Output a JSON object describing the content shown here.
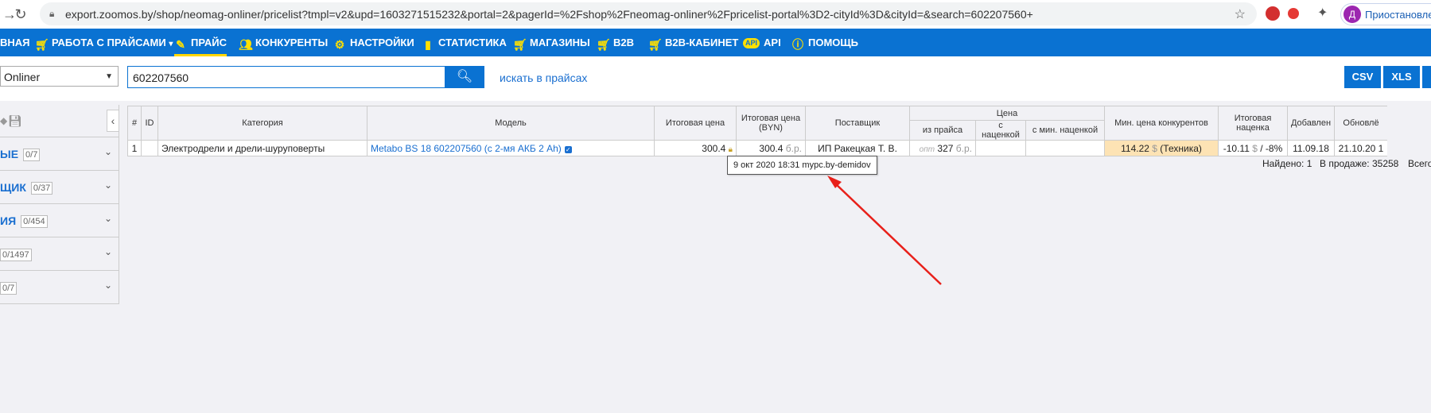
{
  "browser": {
    "url": "export.zoomos.by/shop/neomag-onliner/pricelist?tmpl=v2&upd=1603271515232&portal=2&pagerId=%2Fshop%2Fneomag-onliner%2Fpricelist-portal%3D2-cityId%3D&cityId=&search=602207560+",
    "profile_initial": "Д",
    "profile_label": "Приостановле"
  },
  "nav": {
    "items": [
      {
        "label": "ВНАЯ",
        "icon": "home-icon"
      },
      {
        "label": "РАБОТА С ПРАЙСАМИ",
        "icon": "cart-icon"
      },
      {
        "label": "ПРАЙС",
        "icon": "pricelist-icon"
      },
      {
        "label": "КОНКУРЕНТЫ",
        "icon": "users-icon"
      },
      {
        "label": "НАСТРОЙКИ",
        "icon": "gear-icon"
      },
      {
        "label": "СТАТИСТИКА",
        "icon": "chart-icon"
      },
      {
        "label": "МАГАЗИНЫ",
        "icon": "cart-icon"
      },
      {
        "label": "B2B",
        "icon": "cart-icon"
      },
      {
        "label": "B2B-КАБИНЕТ",
        "icon": "cart-icon"
      },
      {
        "label": "API",
        "icon": "api-icon"
      },
      {
        "label": "ПОМОЩЬ",
        "icon": "info-icon"
      }
    ],
    "api_badge": "API"
  },
  "search": {
    "portal_selected": "Onliner",
    "query": "602207560",
    "search_prices_link": "искать в прайсах",
    "export_buttons": [
      "CSV",
      "XLS"
    ]
  },
  "sidebar": {
    "facets": [
      {
        "title": "ЫЕ",
        "count": "0/7"
      },
      {
        "title": "ЩИК",
        "count": "0/37"
      },
      {
        "title": "ИЯ",
        "count": "0/454"
      },
      {
        "title": "",
        "count": "0/1497"
      },
      {
        "title": "",
        "count": "0/7"
      }
    ]
  },
  "table": {
    "headers": {
      "num": "#",
      "id": "ID",
      "category": "Категория",
      "model": "Модель",
      "final_price": "Итоговая цена",
      "final_price_byn": "Итоговая цена (BYN)",
      "supplier": "Поставщик",
      "price_group": "Цена",
      "from_price": "из прайса",
      "with_markup": "с наценкой",
      "with_min_markup": "с мин. наценкой",
      "min_competitor": "Мин. цена конкурентов",
      "final_markup": "Итоговая наценка",
      "added": "Добавлен",
      "updated": "Обновлё"
    },
    "rows": [
      {
        "num": "1",
        "id": "",
        "category": "Электродрели и дрели-шуруповерты",
        "model": "Metabo BS 18 602207560 (с 2-мя АКБ 2 Ah)",
        "final_price": "300.4",
        "final_price_byn": "300.4",
        "final_price_byn_unit": "б.р.",
        "supplier": "ИП Ракецкая Т. В.",
        "from_price_tag": "опт",
        "from_price": "327",
        "from_price_unit": "б.р.",
        "with_markup": "",
        "with_min_markup": "",
        "min_competitor": "114.22",
        "min_competitor_currency": "$",
        "min_competitor_shop": "(Техника)",
        "final_markup_value": "-10.11",
        "final_markup_currency": "$",
        "final_markup_percent": "/ -8%",
        "added": "11.09.18",
        "updated": "21.10.20 1"
      }
    ]
  },
  "tooltip": "9 окт 2020 18:31 mypc.by-demidov",
  "summary": {
    "found": "Найдено: 1",
    "in_sale": "В продаже: 35258",
    "total": "Всего"
  },
  "colors": {
    "nav_bg": "#0a72d2",
    "accent_yellow": "#ffe000",
    "link_blue": "#1a6fd0",
    "min_price_bg": "#fde3b4",
    "arrow_red": "#e8201a"
  }
}
